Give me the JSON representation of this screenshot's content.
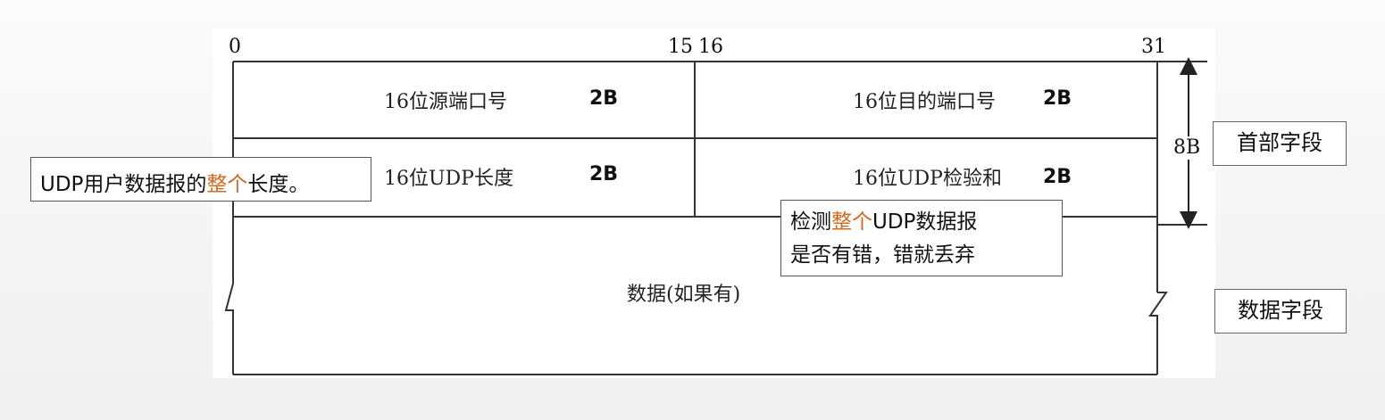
{
  "bit_labels": {
    "start": "0",
    "end_first": "15",
    "start_second": "16",
    "end": "31"
  },
  "header_fields": {
    "src_port": {
      "label": "16位源端口号",
      "size": "2B"
    },
    "dst_port": {
      "label": "16位目的端口号",
      "size": "2B"
    },
    "length": {
      "label": "16位UDP长度",
      "size": "2B"
    },
    "checksum": {
      "label": "16位UDP检验和",
      "size": "2B"
    }
  },
  "data_field": {
    "label": "数据(如果有)"
  },
  "header_size": "8B",
  "side_labels": {
    "header": "首部字段",
    "data": "数据字段"
  },
  "callouts": {
    "length_note": {
      "before": "UDP用户数据报的",
      "highlight": "整个",
      "after": "长度。"
    },
    "checksum_note": {
      "line1_before": "检测",
      "line1_highlight": "整个",
      "line1_after": "UDP数据报",
      "line2": "是否有错，错就丢弃"
    }
  },
  "colors": {
    "highlight": "#d2691e",
    "line": "#333333"
  }
}
